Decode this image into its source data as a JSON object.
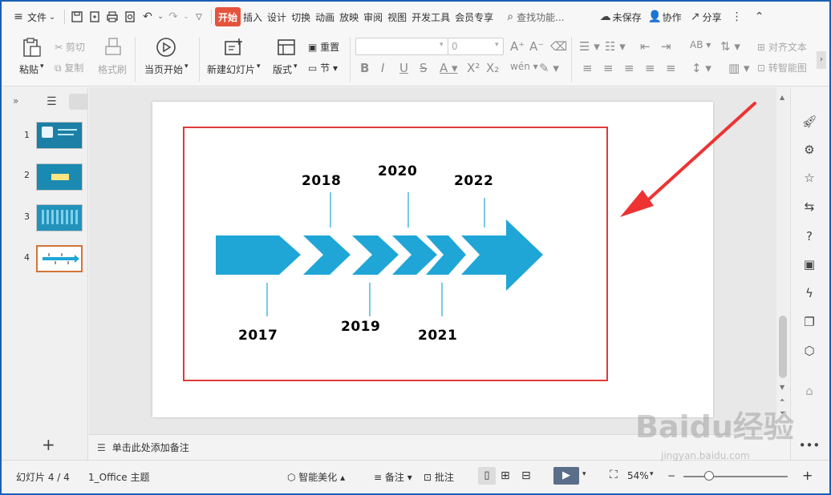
{
  "menubar": {
    "file": "文件",
    "tabs": [
      "开始",
      "插入",
      "设计",
      "切换",
      "动画",
      "放映",
      "审阅",
      "视图",
      "开发工具",
      "会员专享"
    ],
    "search": "查找功能...",
    "unsaved": "未保存",
    "collab": "协作",
    "share": "分享"
  },
  "ribbon": {
    "paste": "粘贴",
    "cut": "剪切",
    "copy": "复制",
    "format_painter": "格式刷",
    "from_current": "当页开始",
    "new_slide": "新建幻灯片",
    "layout": "版式",
    "reset": "重置",
    "section": "节",
    "font_size": "0",
    "align_text": "对齐文本",
    "smartart": "转智能图"
  },
  "thumbnails": [
    "1",
    "2",
    "3",
    "4"
  ],
  "slide": {
    "years_top": [
      "2018",
      "2020",
      "2022"
    ],
    "years_bottom": [
      "2017",
      "2019",
      "2021"
    ],
    "arrow_color": "#1fa6d6",
    "frame_color": "#e03a3a"
  },
  "notes": {
    "placeholder": "单击此处添加备注"
  },
  "statusbar": {
    "slide_count": "幻灯片 4 / 4",
    "theme": "1_Office 主题",
    "beautify": "智能美化",
    "notes": "备注",
    "comments": "批注",
    "zoom": "54%"
  },
  "watermark": {
    "main": "Baidu经验",
    "sub": "jingyan.baidu.com"
  }
}
